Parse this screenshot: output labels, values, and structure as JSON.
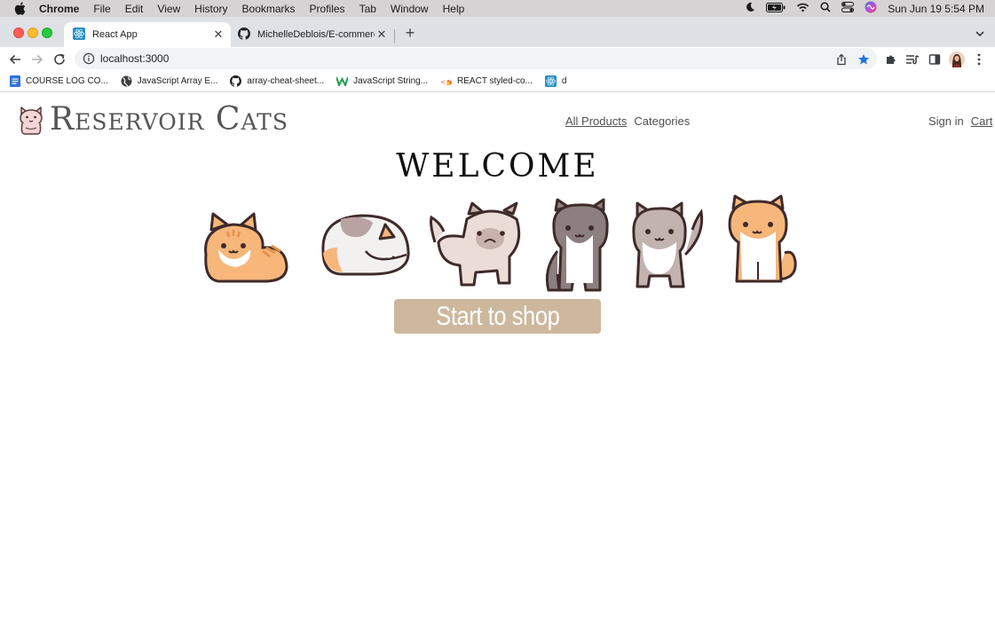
{
  "menubar": {
    "app": "Chrome",
    "items": [
      "File",
      "Edit",
      "View",
      "History",
      "Bookmarks",
      "Profiles",
      "Tab",
      "Window",
      "Help"
    ],
    "clock": "Sun Jun 19  5:54 PM"
  },
  "tabs": [
    {
      "title": "React App",
      "icon": "react-icon",
      "active": true
    },
    {
      "title": "MichelleDeblois/E-commerce",
      "icon": "github-icon",
      "active": false
    }
  ],
  "toolbar": {
    "url": "localhost:3000"
  },
  "bookmarks": [
    {
      "label": "COURSE LOG CO...",
      "icon": "docs-icon"
    },
    {
      "label": "JavaScript Array E...",
      "icon": "globe-icon"
    },
    {
      "label": "array-cheat-sheet...",
      "icon": "github-icon"
    },
    {
      "label": "JavaScript String...",
      "icon": "w-icon"
    },
    {
      "label": "REACT styled-co...",
      "icon": "styled-components-icon"
    },
    {
      "label": "d",
      "icon": "react-icon"
    }
  ],
  "site": {
    "brand": "Reservoir Cats",
    "nav_center": [
      "All Products",
      "Categories"
    ],
    "nav_right": [
      "Sign in",
      "Cart"
    ],
    "welcome": "WELCOME",
    "cta": "Start to shop"
  },
  "colors": {
    "cta_bg": "#cdb89d",
    "brand_text": "#555555",
    "tab_strip": "#dee1e6",
    "star_blue": "#1a73e8"
  }
}
